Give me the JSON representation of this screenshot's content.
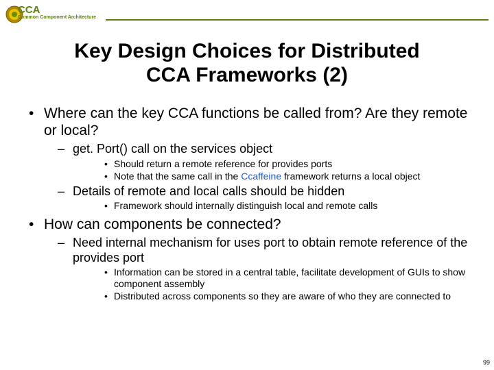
{
  "header": {
    "acronym": "CCA",
    "subtitle": "Common Component Architecture"
  },
  "title_line1": "Key Design Choices for Distributed",
  "title_line2": "CCA Frameworks (2)",
  "bullets": {
    "b1": "Where can the key CCA functions be called from? Are they remote or local?",
    "b1_1": "get. Port() call on the services object",
    "b1_1_1": "Should return a remote reference for provides ports",
    "b1_1_2a": "Note that the same call in the ",
    "b1_1_2_link": "Ccaffeine",
    "b1_1_2b": " framework returns a local object",
    "b1_2": "Details of remote and local calls should be hidden",
    "b1_2_1": "Framework should internally distinguish local and remote calls",
    "b2": "How can components be connected?",
    "b2_1": "Need internal mechanism for uses port to obtain remote reference of the provides port",
    "b2_1_1": "Information can be stored in a central table, facilitate development of GUIs to show component assembly",
    "b2_1_2": "Distributed across components so they are aware of who they are connected to"
  },
  "pagenum": "99"
}
